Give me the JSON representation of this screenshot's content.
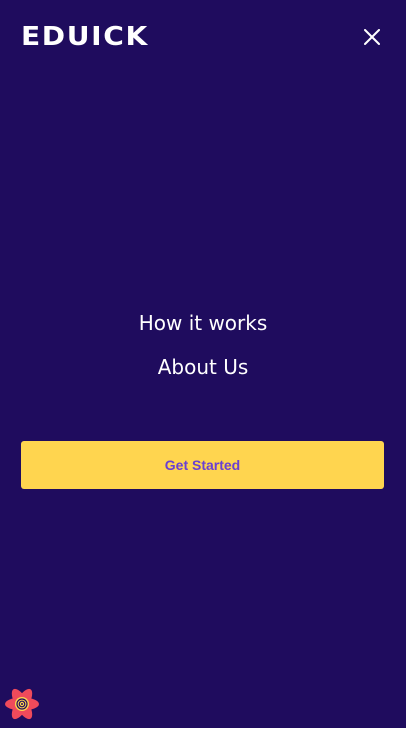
{
  "header": {
    "logo_text": "EDUICK",
    "close_icon": "close-icon"
  },
  "nav": {
    "items": [
      {
        "label": "How it works"
      },
      {
        "label": "About Us"
      }
    ]
  },
  "cta": {
    "label": "Get Started"
  },
  "devtools": {
    "icon": "react-query-devtools-icon"
  },
  "colors": {
    "background": "#1f0c5e",
    "cta_background": "#ffd54f",
    "cta_text": "#6a3fd3",
    "text": "#ffffff"
  }
}
